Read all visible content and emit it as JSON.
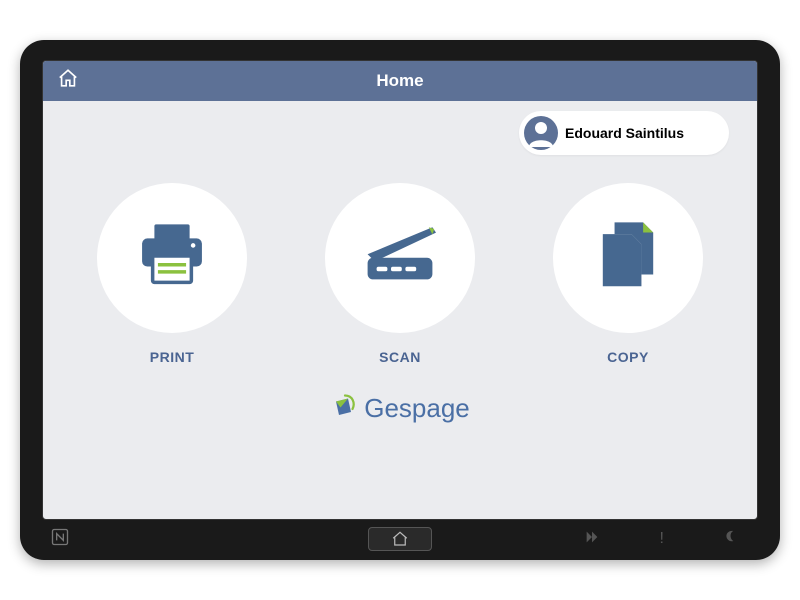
{
  "header": {
    "title": "Home"
  },
  "user": {
    "name": "Edouard Saintilus"
  },
  "actions": {
    "print": {
      "label": "PRINT"
    },
    "scan": {
      "label": "SCAN"
    },
    "copy": {
      "label": "COPY"
    }
  },
  "logo": {
    "text": "Gespage"
  },
  "colors": {
    "accent": "#5d7196",
    "icon_blue": "#466890",
    "icon_green": "#8bc13f"
  }
}
